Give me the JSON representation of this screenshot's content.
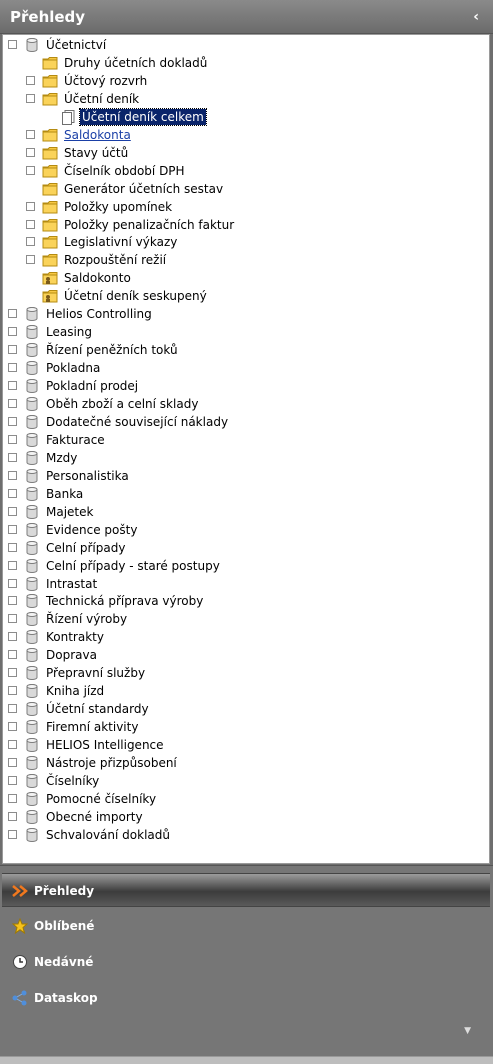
{
  "header": {
    "title": "Přehledy",
    "collapse_glyph": "‹"
  },
  "tree": {
    "nodes": [
      {
        "label": "Účetnictví",
        "icon": "database-icon",
        "level": 0,
        "expander": "−"
      },
      {
        "label": "Druhy účetních dokladů",
        "icon": "folder-icon",
        "level": 1,
        "expander": ""
      },
      {
        "label": "Účtový rozvrh",
        "icon": "folder-icon",
        "level": 1,
        "expander": "+"
      },
      {
        "label": "Účetní deník",
        "icon": "folder-icon",
        "level": 1,
        "expander": "−"
      },
      {
        "label": "Účetní deník celkem",
        "icon": "document-icon",
        "level": 2,
        "expander": "",
        "selected": true
      },
      {
        "label": "Saldokonta",
        "icon": "folder-icon",
        "level": 1,
        "expander": "+",
        "link": true
      },
      {
        "label": "Stavy účtů",
        "icon": "folder-icon",
        "level": 1,
        "expander": "+"
      },
      {
        "label": "Číselník období DPH",
        "icon": "folder-icon",
        "level": 1,
        "expander": "+"
      },
      {
        "label": "Generátor účetních sestav",
        "icon": "folder-icon",
        "level": 1,
        "expander": ""
      },
      {
        "label": "Položky upomínek",
        "icon": "folder-icon",
        "level": 1,
        "expander": "+"
      },
      {
        "label": "Položky penalizačních faktur",
        "icon": "folder-icon",
        "level": 1,
        "expander": "+"
      },
      {
        "label": "Legislativní výkazy",
        "icon": "folder-icon",
        "level": 1,
        "expander": "+"
      },
      {
        "label": "Rozpouštění režií",
        "icon": "folder-icon",
        "level": 1,
        "expander": "+"
      },
      {
        "label": "Saldokonto",
        "icon": "shared-folder-icon",
        "level": 1,
        "expander": ""
      },
      {
        "label": "Účetní deník seskupený",
        "icon": "shared-folder-icon",
        "level": 1,
        "expander": ""
      },
      {
        "label": "Helios Controlling",
        "icon": "database-icon",
        "level": 0,
        "expander": "+"
      },
      {
        "label": "Leasing",
        "icon": "database-icon",
        "level": 0,
        "expander": "+"
      },
      {
        "label": "Řízení peněžních toků",
        "icon": "database-icon",
        "level": 0,
        "expander": "+"
      },
      {
        "label": "Pokladna",
        "icon": "database-icon",
        "level": 0,
        "expander": "+"
      },
      {
        "label": "Pokladní prodej",
        "icon": "database-icon",
        "level": 0,
        "expander": "+"
      },
      {
        "label": "Oběh zboží a celní sklady",
        "icon": "database-icon",
        "level": 0,
        "expander": "+"
      },
      {
        "label": "Dodatečné související náklady",
        "icon": "database-icon",
        "level": 0,
        "expander": "+"
      },
      {
        "label": "Fakturace",
        "icon": "database-icon",
        "level": 0,
        "expander": "+"
      },
      {
        "label": "Mzdy",
        "icon": "database-icon",
        "level": 0,
        "expander": "+"
      },
      {
        "label": "Personalistika",
        "icon": "database-icon",
        "level": 0,
        "expander": "+"
      },
      {
        "label": "Banka",
        "icon": "database-icon",
        "level": 0,
        "expander": "+"
      },
      {
        "label": "Majetek",
        "icon": "database-icon",
        "level": 0,
        "expander": "+"
      },
      {
        "label": "Evidence pošty",
        "icon": "database-icon",
        "level": 0,
        "expander": "+"
      },
      {
        "label": "Celní případy",
        "icon": "database-icon",
        "level": 0,
        "expander": "+"
      },
      {
        "label": "Celní případy - staré postupy",
        "icon": "database-icon",
        "level": 0,
        "expander": "+"
      },
      {
        "label": "Intrastat",
        "icon": "database-icon",
        "level": 0,
        "expander": "+"
      },
      {
        "label": "Technická příprava výroby",
        "icon": "database-icon",
        "level": 0,
        "expander": "+"
      },
      {
        "label": "Řízení výroby",
        "icon": "database-icon",
        "level": 0,
        "expander": "+"
      },
      {
        "label": "Kontrakty",
        "icon": "database-icon",
        "level": 0,
        "expander": "+"
      },
      {
        "label": "Doprava",
        "icon": "database-icon",
        "level": 0,
        "expander": "+"
      },
      {
        "label": "Přepravní služby",
        "icon": "database-icon",
        "level": 0,
        "expander": "+"
      },
      {
        "label": "Kniha jízd",
        "icon": "database-icon",
        "level": 0,
        "expander": "+"
      },
      {
        "label": "Účetní standardy",
        "icon": "database-icon",
        "level": 0,
        "expander": "+"
      },
      {
        "label": "Firemní aktivity",
        "icon": "database-icon",
        "level": 0,
        "expander": "+"
      },
      {
        "label": "HELIOS Intelligence",
        "icon": "database-icon",
        "level": 0,
        "expander": "+"
      },
      {
        "label": "Nástroje přizpůsobení",
        "icon": "database-icon",
        "level": 0,
        "expander": "+"
      },
      {
        "label": "Číselníky",
        "icon": "database-icon",
        "level": 0,
        "expander": "+"
      },
      {
        "label": "Pomocné číselníky",
        "icon": "database-icon",
        "level": 0,
        "expander": "+"
      },
      {
        "label": "Obecné importy",
        "icon": "database-icon",
        "level": 0,
        "expander": "+"
      },
      {
        "label": "Schvalování dokladů",
        "icon": "database-icon",
        "level": 0,
        "expander": "+"
      }
    ]
  },
  "nav": {
    "items": [
      {
        "label": "Přehledy",
        "icon": "overview-arrows-icon",
        "active": true
      },
      {
        "label": "Oblíbené",
        "icon": "star-icon",
        "active": false
      },
      {
        "label": "Nedávné",
        "icon": "clock-icon",
        "active": false
      },
      {
        "label": "Dataskop",
        "icon": "dataskop-icon",
        "active": false
      }
    ],
    "more_glyph": "▼"
  },
  "colors": {
    "selection": "#0a246a",
    "link": "#1a3fa6",
    "folder": "#f7c843",
    "header_bg": "#7a7a7a"
  }
}
